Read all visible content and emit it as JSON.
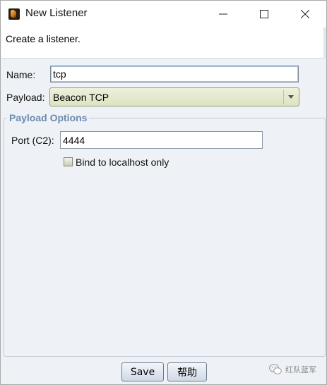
{
  "window": {
    "title": "New Listener"
  },
  "description": "Create a listener.",
  "form": {
    "name_label": "Name:",
    "name_value": "tcp",
    "payload_label": "Payload:",
    "payload_value": "Beacon TCP"
  },
  "payload_options": {
    "title": "Payload Options",
    "port_label": "Port (C2):",
    "port_value": "4444",
    "bind_label": "Bind to localhost only",
    "bind_checked": false
  },
  "buttons": {
    "save": "Save",
    "help": "帮助"
  },
  "watermark": {
    "text": "红队蓝军"
  },
  "colors": {
    "group_title": "#6b8aae",
    "window_bg": "#eef1f6"
  }
}
